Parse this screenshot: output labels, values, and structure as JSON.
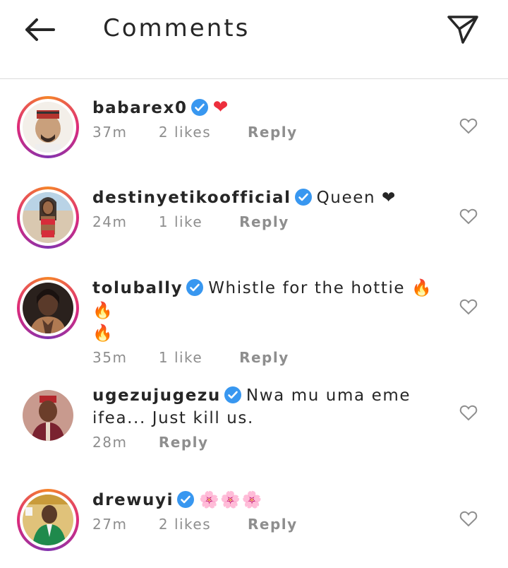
{
  "header": {
    "title": "Comments",
    "back_icon": "arrow-left-icon",
    "share_icon": "send-paper-plane-icon"
  },
  "colors": {
    "verified": "#3897f0",
    "heart_red": "#ed2f3d",
    "muted": "#8e8e8e",
    "story_ring": "#dd2a7b"
  },
  "comments": [
    {
      "username": "babarex0",
      "text": "❤",
      "time": "37m",
      "likes": "2 likes",
      "reply": "Reply",
      "verified": true,
      "avatar_ring": true
    },
    {
      "username": "destinyetikoofficial",
      "text": "Queen ❤",
      "time": "24m",
      "likes": "1 like",
      "reply": "Reply",
      "verified": true,
      "avatar_ring": true
    },
    {
      "username": "tolubally",
      "text": "Whistle for the hottie 🔥 🔥",
      "text2": "🔥",
      "time": "35m",
      "likes": "1 like",
      "reply": "Reply",
      "verified": true,
      "avatar_ring": true
    },
    {
      "username": "ugezujugezu",
      "text": "Nwa mu uma eme",
      "text2": "ifea... Just kill us.",
      "time": "28m",
      "likes": "",
      "reply": "Reply",
      "verified": true,
      "avatar_ring": false
    },
    {
      "username": "drewuyi",
      "text": "🌸🌸🌸",
      "time": "27m",
      "likes": "2 likes",
      "reply": "Reply",
      "verified": true,
      "avatar_ring": true
    }
  ]
}
